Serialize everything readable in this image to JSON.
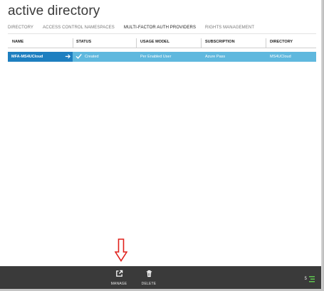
{
  "page": {
    "title": "active directory"
  },
  "tabs": [
    {
      "label": "DIRECTORY",
      "active": false
    },
    {
      "label": "ACCESS CONTROL NAMESPACES",
      "active": false
    },
    {
      "label": "MULTI-FACTOR AUTH PROVIDERS",
      "active": true
    },
    {
      "label": "RIGHTS MANAGEMENT",
      "active": false
    }
  ],
  "table": {
    "columns": [
      "NAME",
      "STATUS",
      "USAGE MODEL",
      "SUBSCRIPTION",
      "DIRECTORY"
    ],
    "rows": [
      {
        "name": "MFA-MS4UCloud",
        "status": "Created",
        "usage_model": "Per Enabled User",
        "subscription": "Azure Pass",
        "directory": "MS4UCloud",
        "selected": true
      }
    ]
  },
  "command_bar": {
    "manage_label": "MANAGE",
    "delete_label": "DELETE",
    "status_count": "5"
  },
  "colors": {
    "accent": "#1e7fc0",
    "row_selected": "#5fb8de",
    "command_bar": "#3a3a3a",
    "callout": "#e0201b",
    "status_green": "#5fc44e"
  },
  "icons": {
    "manage": "external-link-icon",
    "delete": "trash-icon",
    "row_nav": "arrow-right-icon",
    "status": "checkmark-icon",
    "activity": "activity-list-icon",
    "callout": "down-arrow-icon"
  }
}
